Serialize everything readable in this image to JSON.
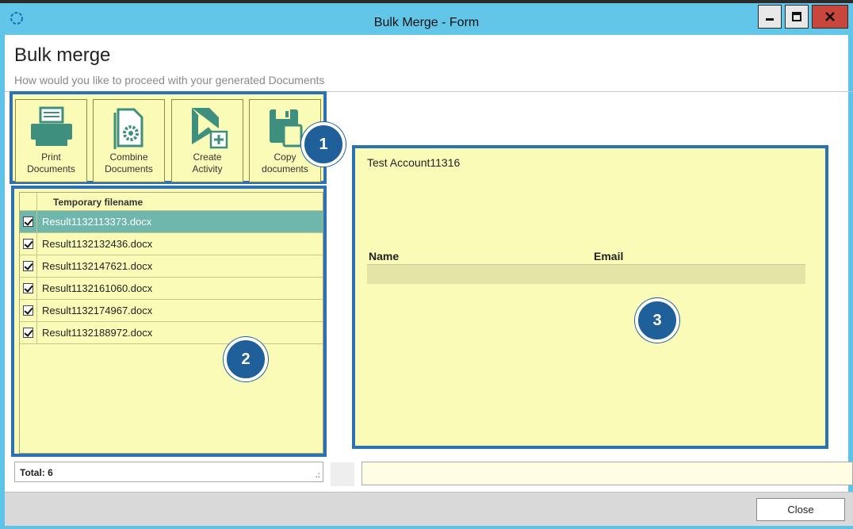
{
  "window": {
    "title": "Bulk Merge - Form"
  },
  "page": {
    "heading": "Bulk merge",
    "subheading": "How would you like to proceed with your generated Documents"
  },
  "toolbar": [
    {
      "line1": "Print",
      "line2": "Documents",
      "icon": "printer-icon"
    },
    {
      "line1": "Combine",
      "line2": "Documents",
      "icon": "combine-document-icon"
    },
    {
      "line1": "Create",
      "line2": "Activity",
      "icon": "create-activity-icon"
    },
    {
      "line1": "Copy",
      "line2": "documents",
      "icon": "copy-documents-icon"
    }
  ],
  "file_list": {
    "header": "Temporary filename",
    "rows": [
      {
        "name": "Result1132113373.docx",
        "checked": true,
        "selected": true
      },
      {
        "name": "Result1132132436.docx",
        "checked": true,
        "selected": false
      },
      {
        "name": "Result1132147621.docx",
        "checked": true,
        "selected": false
      },
      {
        "name": "Result1132161060.docx",
        "checked": true,
        "selected": false
      },
      {
        "name": "Result1132174967.docx",
        "checked": true,
        "selected": false
      },
      {
        "name": "Result1132188972.docx",
        "checked": true,
        "selected": false
      }
    ]
  },
  "preview": {
    "title": "Test Account11316",
    "columns": [
      "Name",
      "Email"
    ]
  },
  "badges": [
    "1",
    "2",
    "3"
  ],
  "footer": {
    "total": "Total:  6",
    "close_label": "Close"
  },
  "colors": {
    "panel": "#fbfbb8",
    "highlight_border": "#2a72b2",
    "badge": "#1f5f9a",
    "titlebar": "#62c6e8",
    "selected_row": "#6fb7ad"
  }
}
